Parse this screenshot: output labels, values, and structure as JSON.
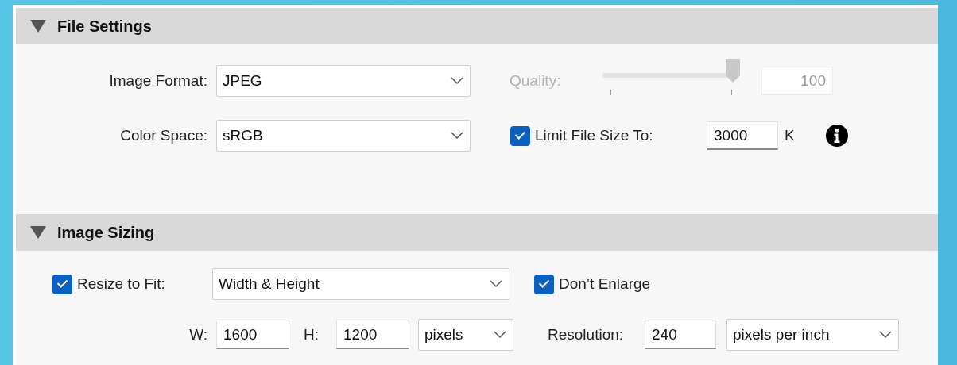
{
  "file_settings": {
    "title": "File Settings",
    "expanded": true,
    "image_format": {
      "label": "Image Format:",
      "value": "JPEG"
    },
    "color_space": {
      "label": "Color Space:",
      "value": "sRGB"
    },
    "quality": {
      "label": "Quality:",
      "disabled": true,
      "level": 1,
      "value": "100"
    },
    "limit_file_size": {
      "label": "Limit File Size To:",
      "checked": true,
      "value": "3000",
      "unit": "K"
    }
  },
  "image_sizing": {
    "title": "Image Sizing",
    "expanded": true,
    "resize_to_fit": {
      "label": "Resize to Fit:",
      "checked": true,
      "value": "Width & Height"
    },
    "dont_enlarge": {
      "label": "Don’t Enlarge",
      "checked": true
    },
    "width": {
      "label": "W:",
      "value": "1600"
    },
    "height": {
      "label": "H:",
      "value": "1200"
    },
    "size_unit": {
      "value": "pixels"
    },
    "resolution": {
      "label": "Resolution:",
      "value": "240",
      "unit": "pixels per inch"
    }
  }
}
